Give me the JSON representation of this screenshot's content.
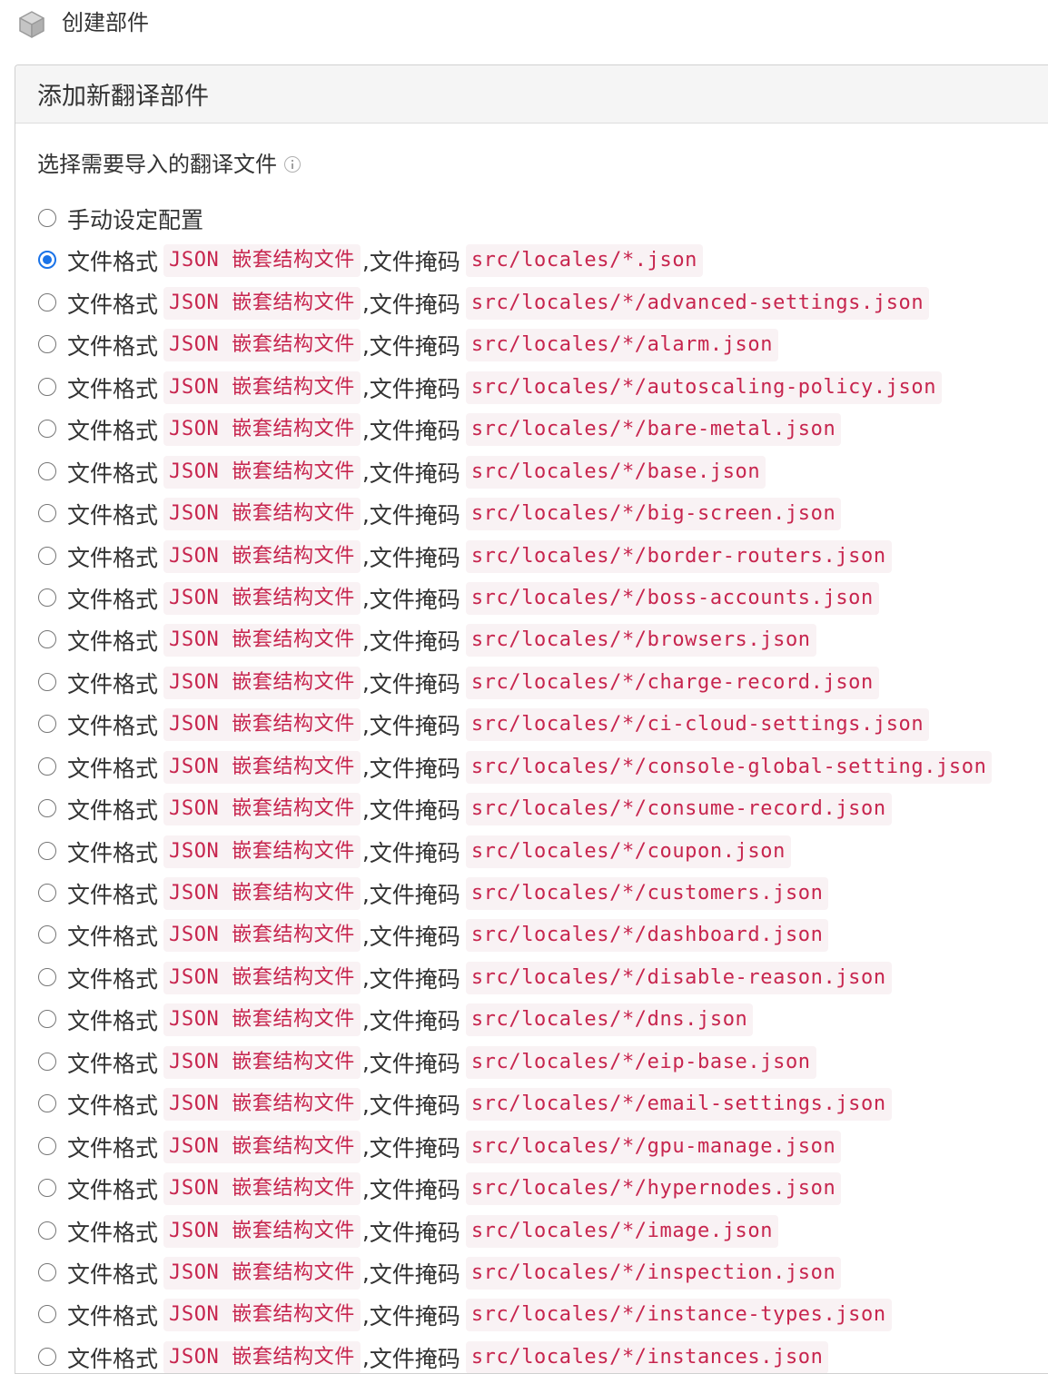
{
  "page": {
    "title": "创建部件",
    "icon": "cube-icon"
  },
  "panel": {
    "heading": "添加新翻译部件",
    "section_label": "选择需要导入的翻译文件",
    "info_icon": "info-icon"
  },
  "options": {
    "manual": {
      "label": "手动设定配置",
      "checked": false
    },
    "format_prefix": "文件格式",
    "mask_prefix": "文件掩码",
    "separator": ",",
    "format_value": "JSON 嵌套结构文件",
    "items": [
      {
        "mask": "src/locales/*.json",
        "checked": true
      },
      {
        "mask": "src/locales/*/advanced-settings.json",
        "checked": false
      },
      {
        "mask": "src/locales/*/alarm.json",
        "checked": false
      },
      {
        "mask": "src/locales/*/autoscaling-policy.json",
        "checked": false
      },
      {
        "mask": "src/locales/*/bare-metal.json",
        "checked": false
      },
      {
        "mask": "src/locales/*/base.json",
        "checked": false
      },
      {
        "mask": "src/locales/*/big-screen.json",
        "checked": false
      },
      {
        "mask": "src/locales/*/border-routers.json",
        "checked": false
      },
      {
        "mask": "src/locales/*/boss-accounts.json",
        "checked": false
      },
      {
        "mask": "src/locales/*/browsers.json",
        "checked": false
      },
      {
        "mask": "src/locales/*/charge-record.json",
        "checked": false
      },
      {
        "mask": "src/locales/*/ci-cloud-settings.json",
        "checked": false
      },
      {
        "mask": "src/locales/*/console-global-setting.json",
        "checked": false
      },
      {
        "mask": "src/locales/*/consume-record.json",
        "checked": false
      },
      {
        "mask": "src/locales/*/coupon.json",
        "checked": false
      },
      {
        "mask": "src/locales/*/customers.json",
        "checked": false
      },
      {
        "mask": "src/locales/*/dashboard.json",
        "checked": false
      },
      {
        "mask": "src/locales/*/disable-reason.json",
        "checked": false
      },
      {
        "mask": "src/locales/*/dns.json",
        "checked": false
      },
      {
        "mask": "src/locales/*/eip-base.json",
        "checked": false
      },
      {
        "mask": "src/locales/*/email-settings.json",
        "checked": false
      },
      {
        "mask": "src/locales/*/gpu-manage.json",
        "checked": false
      },
      {
        "mask": "src/locales/*/hypernodes.json",
        "checked": false
      },
      {
        "mask": "src/locales/*/image.json",
        "checked": false
      },
      {
        "mask": "src/locales/*/inspection.json",
        "checked": false
      },
      {
        "mask": "src/locales/*/instance-types.json",
        "checked": false
      },
      {
        "mask": "src/locales/*/instances.json",
        "checked": false
      }
    ]
  },
  "colors": {
    "radio_checked": "#1a73e8",
    "code_text": "#c7254e",
    "code_bg": "#f9f2f4",
    "heading_bg": "#f5f5f5"
  }
}
